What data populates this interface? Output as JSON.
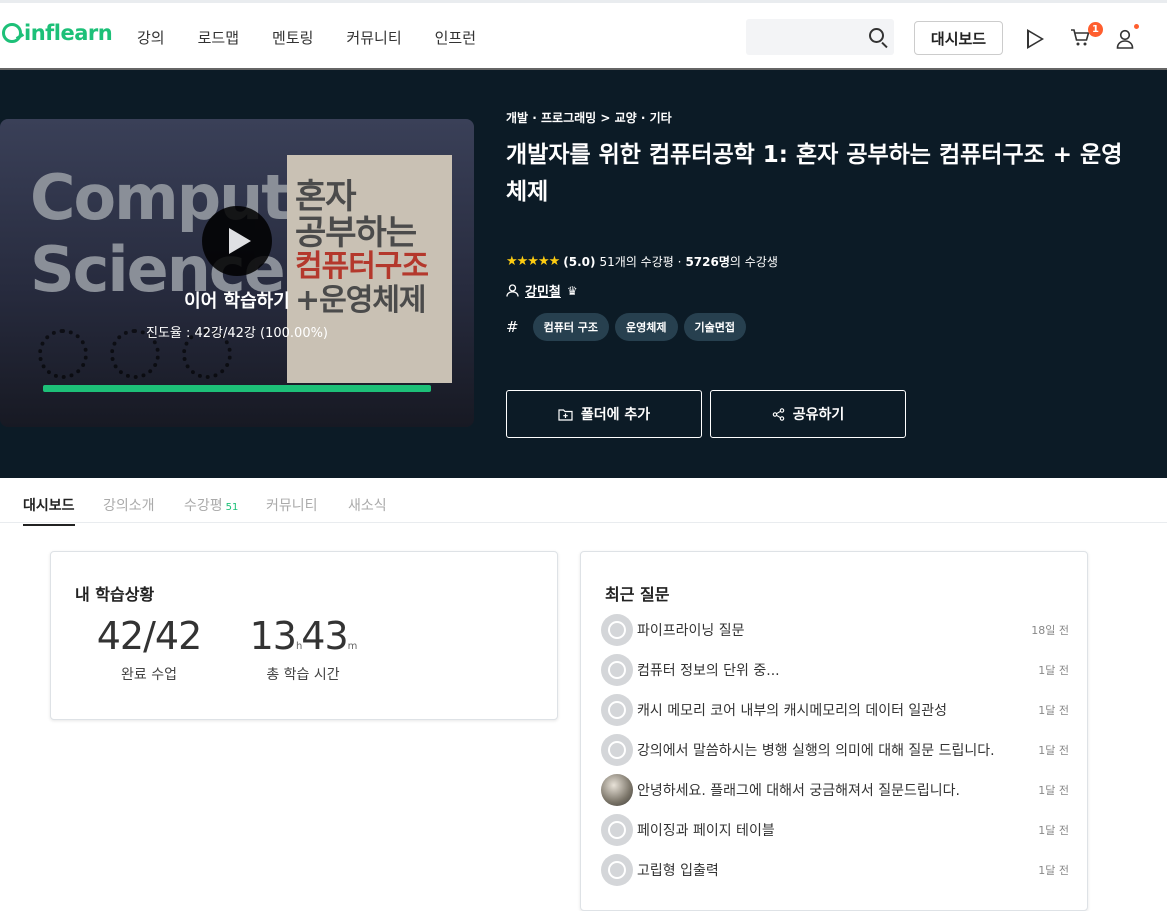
{
  "header": {
    "logo_text": "inflearn",
    "nav": [
      "강의",
      "로드맵",
      "멘토링",
      "커뮤니티",
      "인프런"
    ],
    "dashboard_label": "대시보드",
    "cart_count": "1"
  },
  "hero": {
    "thumbnail": {
      "word1": "Computer",
      "word2": "Science",
      "book_lines": [
        "혼자",
        "공부하는",
        "컴퓨터구조",
        "+운영체제"
      ],
      "resume_label": "이어 학습하기",
      "progress_text": "진도율 : 42강/42강 (100.00%)",
      "progress_fraction": 1.0
    },
    "breadcrumb": "개발 · 프로그래밍 > 교양 · 기타",
    "title": "개발자를 위한 컴퓨터공학 1: 혼자 공부하는 컴퓨터구조 + 운영체제",
    "stars": "★★★★★",
    "rating": "(5.0)",
    "reviews": "51개의 수강평 ·",
    "students": "5726명",
    "students_suffix": "의 수강생",
    "instructor": "강민철",
    "tags": [
      "컴퓨터 구조",
      "운영체제",
      "기술면접"
    ],
    "folder_button": "폴더에 추가",
    "share_button": "공유하기"
  },
  "tabs": [
    {
      "label": "대시보드",
      "active": true
    },
    {
      "label": "강의소개",
      "active": false
    },
    {
      "label": "수강평",
      "count": "51",
      "active": false
    },
    {
      "label": "커뮤니티",
      "active": false
    },
    {
      "label": "새소식",
      "active": false
    }
  ],
  "my_progress": {
    "title": "내 학습상황",
    "completed_value": "42/42",
    "completed_label": "완료 수업",
    "time_hours": "13",
    "time_hours_unit": "h",
    "time_minutes": "43",
    "time_minutes_unit": "m",
    "time_label": "총 학습 시간"
  },
  "recent_questions": {
    "title": "최근 질문",
    "items": [
      {
        "text": "파이프라이닝 질문",
        "time": "18일 전",
        "photo": false
      },
      {
        "text": "컴퓨터 정보의 단위 중...",
        "time": "1달 전",
        "photo": false
      },
      {
        "text": "캐시 메모리 코어 내부의 캐시메모리의 데이터 일관성",
        "time": "1달 전",
        "photo": false
      },
      {
        "text": "강의에서 말씀하시는 병행 실행의 의미에 대해 질문 드립니다.",
        "time": "1달 전",
        "photo": false
      },
      {
        "text": "안녕하세요. 플래그에 대해서 궁금해져서 질문드립니다.",
        "time": "1달 전",
        "photo": true
      },
      {
        "text": "페이징과 페이지 테이블",
        "time": "1달 전",
        "photo": false
      },
      {
        "text": "고립형 입출력",
        "time": "1달 전",
        "photo": false
      }
    ]
  },
  "colors": {
    "brand": "#1dc078",
    "hero_bg": "#0c1b26",
    "badge": "#ff5e2e",
    "star": "#fdcc11"
  }
}
